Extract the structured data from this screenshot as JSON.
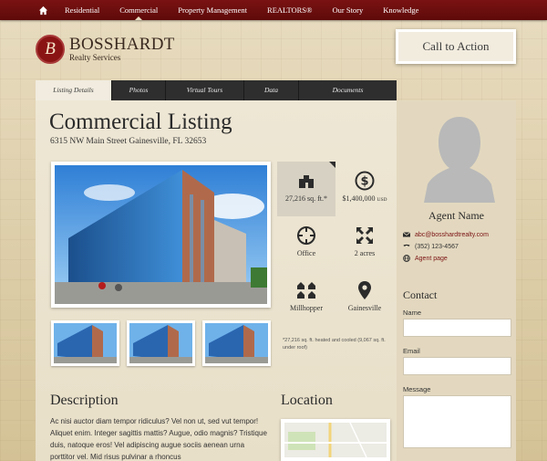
{
  "nav": {
    "items": [
      "Residential",
      "Commercial",
      "Property Management",
      "REALTORS®",
      "Our Story",
      "Knowledge"
    ],
    "active": "Commercial"
  },
  "logo": {
    "title": "BOSSHARDT",
    "subtitle": "Realty Services",
    "mark": "B"
  },
  "cta": {
    "label": "Call to Action"
  },
  "tabs": [
    "Listing Details",
    "Photos",
    "Virtual Tours",
    "Data",
    "Documents"
  ],
  "listing": {
    "title": "Commercial Listing",
    "address": "6315 NW Main Street Gainesville, FL 32653",
    "stats": {
      "sqft": "27,216 sq. ft.*",
      "price": "$1,400,000",
      "price_unit": "USD",
      "type": "Office",
      "acres": "2 acres",
      "area": "Millhopper",
      "city": "Gainesville"
    },
    "footnote": "*27,216 sq. ft. heated and cooled (9,067 sq. ft. under roof)"
  },
  "description": {
    "heading": "Description",
    "text": "Ac nisi auctor diam tempor ridiculus? Vel non ut, sed vut tempor! Aliquet enim. Integer sagittis mattis? Augue, odio magnis? Tristique duis, natoque eros! Vel adipiscing augue sociis aenean urna porttitor vel. Mid risus pulvinar a rhoncus"
  },
  "location": {
    "heading": "Location"
  },
  "agent": {
    "name": "Agent Name",
    "email": "abc@bosshardtrealty.com",
    "phone": "(352) 123-4567",
    "page_link": "Agent page"
  },
  "contact": {
    "heading": "Contact",
    "name_label": "Name",
    "email_label": "Email",
    "message_label": "Message"
  },
  "colors": {
    "brand": "#7a1212",
    "tabbar": "#2e2e2e",
    "panel": "#ede6d3"
  }
}
